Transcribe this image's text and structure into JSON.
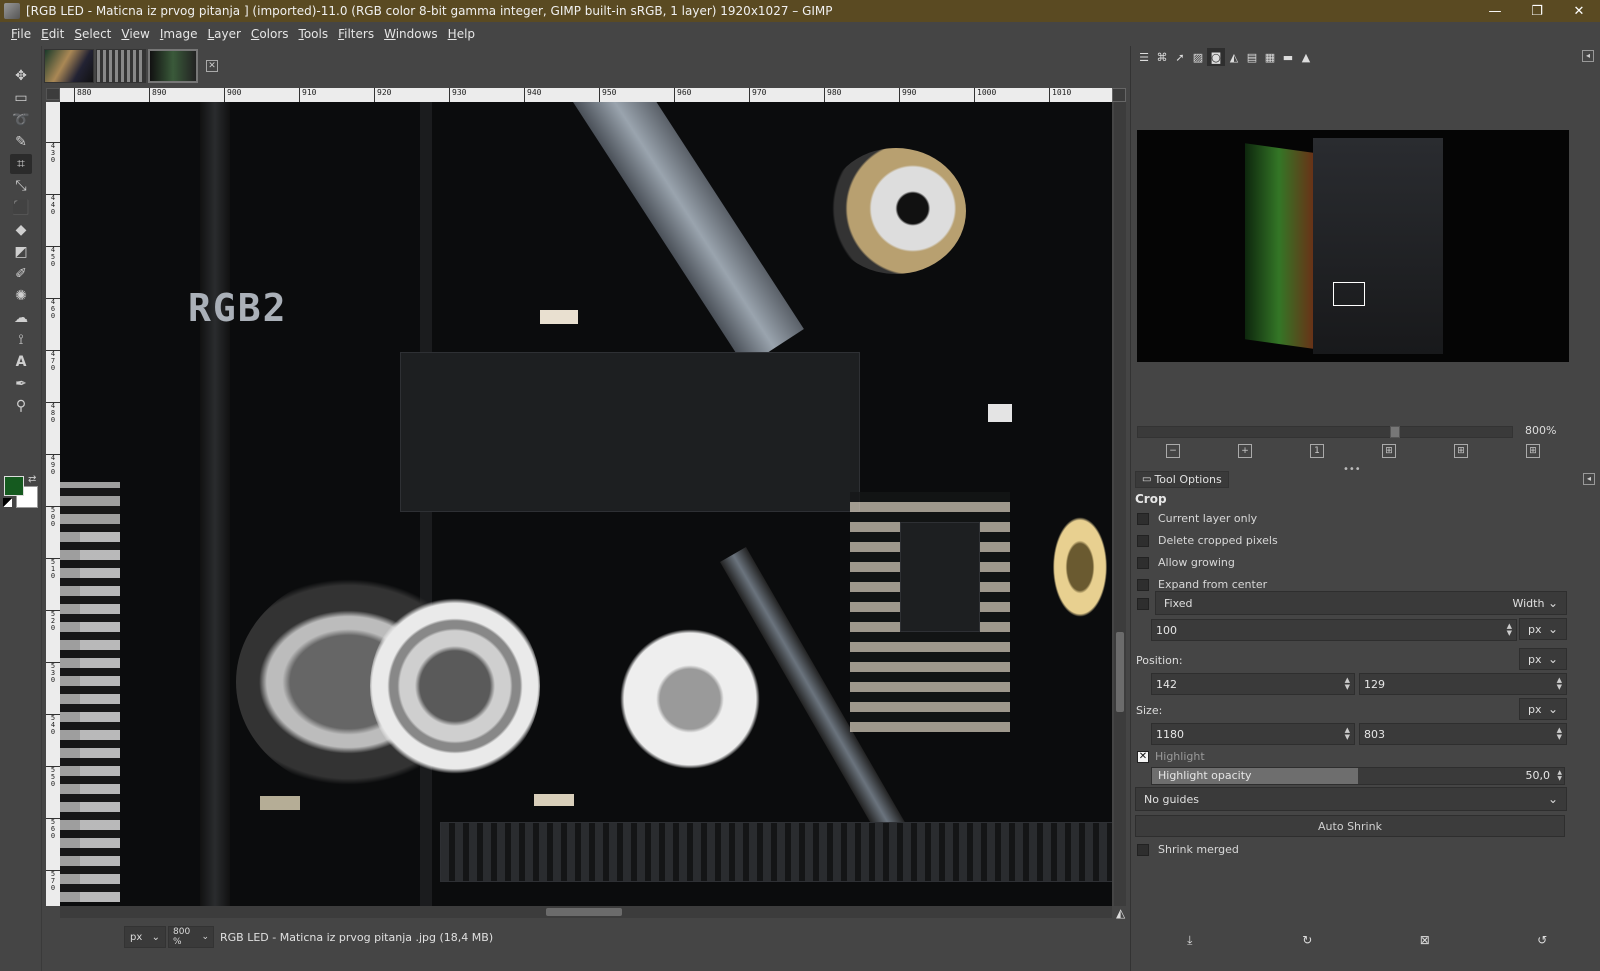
{
  "window": {
    "title": "[RGB LED - Maticna iz prvog pitanja ] (imported)-11.0 (RGB color 8-bit gamma integer, GIMP built-in sRGB, 1 layer) 1920x1027 – GIMP",
    "minimize": "—",
    "maximize": "❐",
    "close": "✕"
  },
  "menu": [
    "File",
    "Edit",
    "Select",
    "View",
    "Image",
    "Layer",
    "Colors",
    "Tools",
    "Filters",
    "Windows",
    "Help"
  ],
  "colors": {
    "foreground": "#155a1f",
    "background": "#ffffff",
    "accent": "#5a4a22"
  },
  "ruler": {
    "h_labels": [
      "880",
      "890",
      "900",
      "910",
      "920",
      "930",
      "940",
      "950",
      "960",
      "970",
      "980",
      "990",
      "1000",
      "1010"
    ],
    "v_labels": [
      "4\n3\n0",
      "4\n4\n0",
      "4\n5\n0",
      "4\n6\n0",
      "4\n7\n0",
      "4\n8\n0",
      "4\n9\n0",
      "5\n0\n0",
      "5\n1\n0",
      "5\n2\n0",
      "5\n3\n0",
      "5\n4\n0",
      "5\n5\n0",
      "5\n6\n0",
      "5\n7\n0",
      "5\n8\n0"
    ]
  },
  "canvas": {
    "silkscreen_text": "RGB2"
  },
  "statusbar": {
    "unit": "px",
    "zoom": "800 %",
    "info": "RGB LED - Maticna iz prvog pitanja .jpg (18,4 MB)"
  },
  "navigation": {
    "zoom_label": "800%"
  },
  "tool_options": {
    "tab_label": "Tool Options",
    "title": "Crop",
    "current_layer_only": "Current layer only",
    "delete_cropped": "Delete cropped pixels",
    "allow_growing": "Allow growing",
    "expand_center": "Expand from center",
    "fixed_label": "Fixed",
    "fixed_mode": "Width",
    "fixed_value": "100",
    "fixed_unit": "px",
    "position_label": "Position:",
    "position_unit": "px",
    "position_x": "142",
    "position_y": "129",
    "size_label": "Size:",
    "size_unit": "px",
    "size_w": "1180",
    "size_h": "803",
    "highlight": "Highlight",
    "highlight_opacity_label": "Highlight opacity",
    "highlight_opacity_value": "50,0",
    "highlight_opacity_fraction": 0.5,
    "guides": "No guides",
    "auto_shrink": "Auto Shrink",
    "shrink_merged": "Shrink merged"
  }
}
